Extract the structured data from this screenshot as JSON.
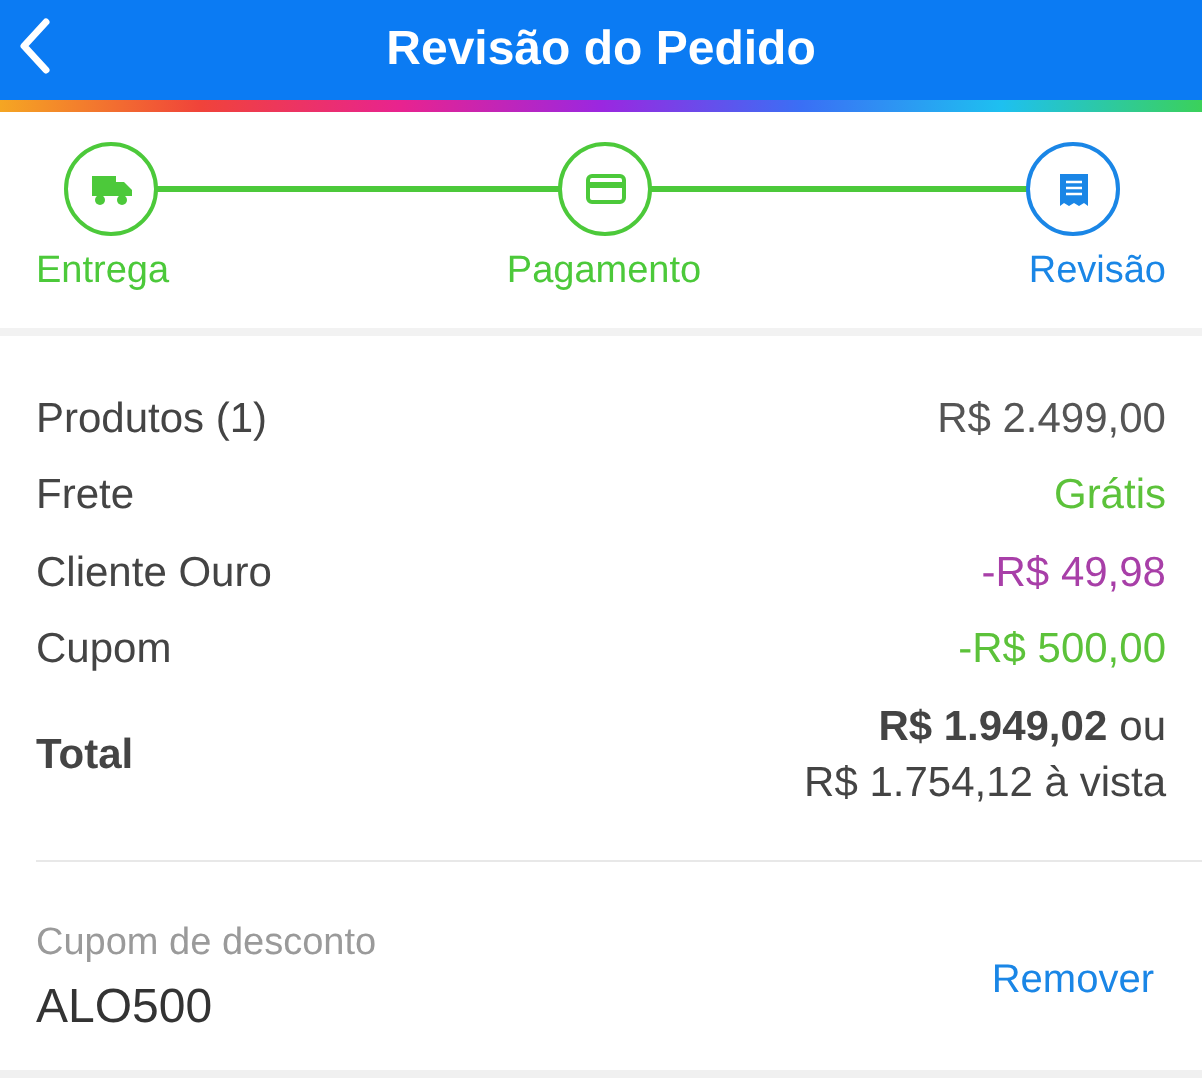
{
  "header": {
    "title": "Revisão do Pedido"
  },
  "steps": [
    {
      "kind": "truck",
      "label": "Entrega",
      "selected": false
    },
    {
      "kind": "card",
      "label": "Pagamento",
      "selected": false
    },
    {
      "kind": "receipt",
      "label": "Revisão",
      "selected": true
    }
  ],
  "summary": [
    {
      "label": "Produtos (1)",
      "value": "R$ 2.499,00",
      "color": "#555555"
    },
    {
      "label": "Frete",
      "value": "Grátis",
      "color": "#5cc23a"
    },
    {
      "label": "Cliente Ouro",
      "value": "-R$ 49,98",
      "color": "#a83fa8"
    },
    {
      "label": "Cupom",
      "value": "-R$ 500,00",
      "color": "#5cc23a"
    }
  ],
  "total": {
    "label": "Total",
    "price": "R$ 1.949,02",
    "connector": "ou",
    "cash_price": "R$ 1.754,12 à vista"
  },
  "coupon": {
    "label": "Cupom de desconto",
    "code": "ALO500",
    "action": "Remover"
  }
}
